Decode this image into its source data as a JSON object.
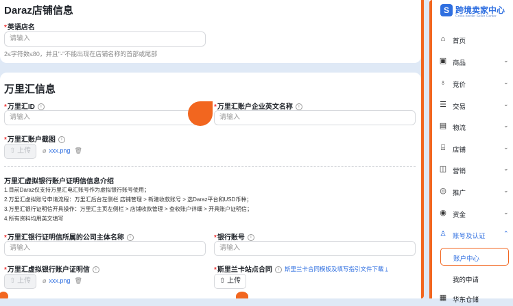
{
  "store": {
    "title": "Daraz店铺信息",
    "name_label": "英语店名",
    "name_placeholder": "请输入",
    "name_hint": "2≤字符数≤80，并且\"-\"不能出现在店铺名称的首部或尾部"
  },
  "wanlihui": {
    "title": "万里汇信息",
    "id_label": "万里汇ID",
    "id_placeholder": "请输入",
    "company_label": "万里汇账户企业英文名称",
    "company_placeholder": "请输入",
    "screenshot_label": "万里汇账户截图",
    "upload_label": "上传",
    "file_name": "xxx.png",
    "intro_title": "万里汇虚拟银行账户证明信信息介绍",
    "intro_lines": [
      "1.目前Daraz仅支持万里汇电汇账号作为虚拟银行账号使用；",
      "2.万里汇虚拟账号申请流程：万里汇后台左侧栏 店铺管理 > 新建收款账号 > 选Daraz平台和USD币种；",
      "3.万里汇银行证明信开具操作：万里汇主页左侧栏 > 店铺收款管理 > 查收账户详细 > 开具账户证明信；",
      "4.所有资料均用英文填写"
    ],
    "bank_company_label": "万里汇银行证明信所属的公司主体名称",
    "bank_company_placeholder": "请输入",
    "bank_account_label": "银行账号",
    "bank_account_placeholder": "请输入",
    "virtual_cert_label": "万里汇虚拟银行账户证明信",
    "virtual_upload_label": "上传",
    "virtual_file_name": "xxx.png",
    "srilanka_label": "斯里兰卡站点合同",
    "srilanka_link": "斯里兰卡合同模板及填写指引文件下载",
    "srilanka_upload_label": "上传"
  },
  "sidebar": {
    "logo_title": "跨境卖家中心",
    "logo_sub": "Cross-border Seller Center",
    "items": [
      {
        "label": "首页",
        "icon": "home-icon"
      },
      {
        "label": "商品",
        "icon": "bag-icon"
      },
      {
        "label": "竞价",
        "icon": "money-bag-icon"
      },
      {
        "label": "交易",
        "icon": "list-icon"
      },
      {
        "label": "物流",
        "icon": "truck-icon"
      },
      {
        "label": "店铺",
        "icon": "shop-icon"
      },
      {
        "label": "营销",
        "icon": "megaphone-icon"
      },
      {
        "label": "推广",
        "icon": "globe-icon"
      },
      {
        "label": "资金",
        "icon": "wallet-icon"
      },
      {
        "label": "账号及认证",
        "icon": "user-icon"
      }
    ],
    "sub_items": [
      "账户中心",
      "我的申请"
    ],
    "next_item": "华东仓储"
  },
  "colors": {
    "accent": "#f2661f",
    "primary": "#2f6fe0"
  }
}
